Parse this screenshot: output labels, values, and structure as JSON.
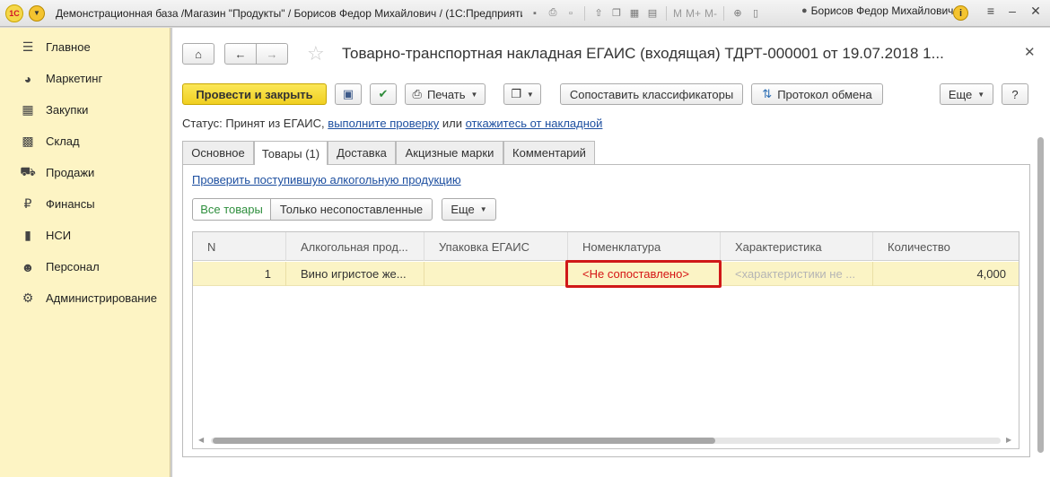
{
  "titlebar": {
    "logo": "1С",
    "title": "Демонстрационная база /Магазин \"Продукты\" / Борисов Федор Михайлович /  (1С:Предприятие)",
    "m_labels": [
      "M",
      "M+",
      "M-"
    ],
    "user": "Борисов Федор Михайлович",
    "info": "i"
  },
  "sidebar": {
    "items": [
      {
        "label": "Главное",
        "icon": "menu-icon"
      },
      {
        "label": "Маркетинг",
        "icon": "pie-chart-icon"
      },
      {
        "label": "Закупки",
        "icon": "purchases-icon"
      },
      {
        "label": "Склад",
        "icon": "warehouse-icon"
      },
      {
        "label": "Продажи",
        "icon": "cart-icon"
      },
      {
        "label": "Финансы",
        "icon": "ruble-icon"
      },
      {
        "label": "НСИ",
        "icon": "book-icon"
      },
      {
        "label": "Персонал",
        "icon": "person-icon"
      },
      {
        "label": "Администрирование",
        "icon": "gear-icon"
      }
    ]
  },
  "form": {
    "title": "Товарно-транспортная накладная ЕГАИС (входящая) ТДРТ-000001 от 19.07.2018 1...",
    "toolbar": {
      "post_close": "Провести и закрыть",
      "print": "Печать",
      "match_classifiers": "Сопоставить классификаторы",
      "exchange_log": "Протокол обмена",
      "more": "Еще",
      "help": "?"
    },
    "status": {
      "prefix": "Статус:",
      "text": "Принят из ЕГАИС,",
      "link_check": "выполните проверку",
      "or": "или",
      "link_reject": "откажитесь от накладной"
    },
    "tabs": [
      "Основное",
      "Товары (1)",
      "Доставка",
      "Акцизные марки",
      "Комментарий"
    ],
    "active_tab": 1,
    "goods": {
      "check_link": "Проверить поступившую алкогольную продукцию",
      "filter_all": "Все товары",
      "filter_unmatched": "Только несопоставленные",
      "more": "Еще",
      "columns": [
        "N",
        "Алкогольная прод...",
        "Упаковка ЕГАИС",
        "Номенклатура",
        "Характеристика",
        "Количество"
      ],
      "rows": [
        {
          "n": "1",
          "product": "Вино игристое же...",
          "package": "",
          "nomenclature": "<Не сопоставлено>",
          "characteristic": "<характеристики не ...",
          "quantity": "4,000"
        }
      ]
    }
  },
  "colors": {
    "sidebar_bg": "#fdf4c4",
    "primary_button": "#f0cf21",
    "link": "#1d4fa0",
    "not_matched": "#d51515",
    "row_selected": "#fbf4c5",
    "highlight_box": "#d01818"
  }
}
